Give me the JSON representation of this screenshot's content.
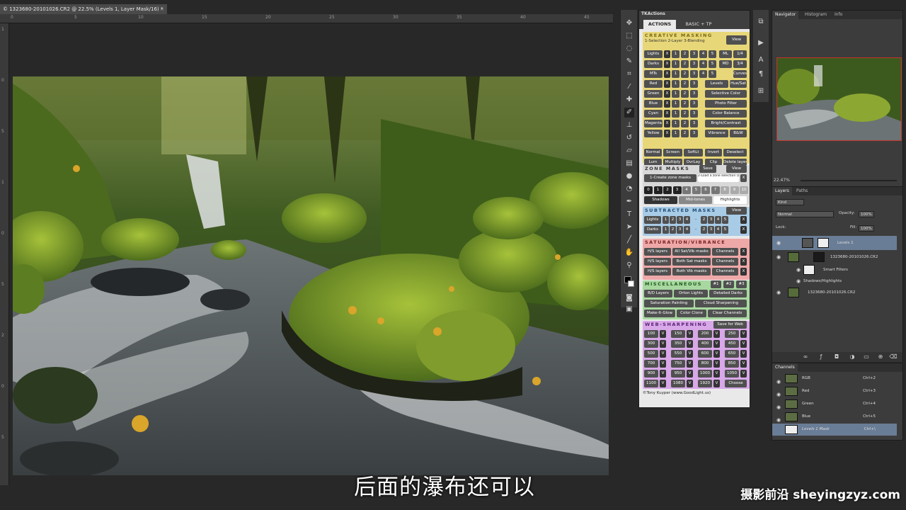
{
  "document": {
    "tab_title": "© 1323680-20101026.CR2 @ 22.5% (Levels 1, Layer Mask/16) *",
    "close": "×"
  },
  "rulers": {
    "top": [
      "0",
      "5",
      "10",
      "15",
      "20",
      "25",
      "30",
      "35",
      "40",
      "45"
    ],
    "left": [
      "1",
      "0",
      "5",
      "1",
      "0",
      "5",
      "2",
      "0",
      "5"
    ]
  },
  "subtitle": "后面的瀑布还可以",
  "watermark": "摄影前沿 sheyingzyz.com",
  "tk_panel": {
    "header": "TKActions",
    "tabs": [
      "ACTIONS",
      "BASIC + TP"
    ],
    "creative": {
      "title": "CREATIVE MASKING",
      "sub": "1-Selection  2-Layer  3-Blending",
      "view": "View",
      "rows": [
        [
          "Lights",
          "ML",
          "1/4"
        ],
        [
          "Darks",
          "MD",
          "3/4"
        ],
        [
          "MTs",
          "",
          "Curves"
        ],
        [
          "Red",
          "Levels",
          "Hue/Sat"
        ],
        [
          "Green",
          "Selective Color",
          ""
        ],
        [
          "Blue",
          "Photo Filter",
          ""
        ],
        [
          "Cyan",
          "Color Balance",
          ""
        ],
        [
          "Magenta",
          "Bright/Contrast",
          ""
        ],
        [
          "Yellow",
          "Vibrance",
          "B&W"
        ]
      ],
      "blend1": [
        "Normal",
        "Screen",
        "SoftLt",
        "Invert",
        "Deselect"
      ],
      "blend2": [
        "Lum",
        "Multiply",
        "OvrLay",
        "Clip",
        "Delete layer"
      ]
    },
    "zone": {
      "title": "ZONE MASKS",
      "save": "Save",
      "view": "View",
      "create": "1-Create zone masks",
      "load": "2-Load a zone selection (below)",
      "x": "X",
      "nums": [
        "0",
        "1",
        "2",
        "3",
        "4",
        "5",
        "6",
        "7",
        "8",
        "9",
        "10"
      ],
      "labels": [
        "Shadows",
        "Mid-tones",
        "Highlights"
      ]
    },
    "subtract": {
      "title": "SUBTRACTED MASKS",
      "view": "View",
      "rows": [
        "Lights",
        "Darks"
      ]
    },
    "saturation": {
      "title": "SATURATION/VIBRANCE",
      "rows": [
        [
          "H/S layers",
          "All Sat/Vib masks",
          "Channels"
        ],
        [
          "H/S layers",
          "Both Sat masks",
          "Channels"
        ],
        [
          "H/S layers",
          "Both Vib masks",
          "Channels"
        ]
      ]
    },
    "misc": {
      "title": "MISCELLANEOUS",
      "nums": [
        "#1",
        "#2",
        "#3"
      ],
      "rows": [
        [
          "B/D Layers",
          "Orton Lights",
          "Detailed Darks"
        ],
        [
          "Saturation Painting",
          "Cloud Sharpening"
        ],
        [
          "Make-It-Glow",
          "Color Clone",
          "Clear Channels"
        ]
      ]
    },
    "web": {
      "title": "WEB-SHARPENING",
      "save": "Save for Web",
      "values": [
        [
          "100",
          "150",
          "200",
          "250"
        ],
        [
          "300",
          "350",
          "400",
          "450"
        ],
        [
          "500",
          "550",
          "600",
          "650"
        ],
        [
          "700",
          "750",
          "800",
          "850"
        ],
        [
          "900",
          "950",
          "1000",
          "1050"
        ],
        [
          "1100",
          "1080",
          "1920",
          "Choose"
        ]
      ]
    },
    "credit": "©Tony Kuyper (www.GoodLight.us)"
  },
  "navigator": {
    "tabs": [
      "Navigator",
      "Histogram",
      "Info"
    ],
    "zoom": "22.47%"
  },
  "layers": {
    "tabs": [
      "Layers",
      "Paths"
    ],
    "kind": "Kind",
    "blend": "Normal",
    "opacity_label": "Opacity:",
    "opacity": "100%",
    "lock_label": "Lock:",
    "fill_label": "Fill:",
    "fill": "100%",
    "items": [
      {
        "name": "Levels 1"
      },
      {
        "name": "1323680-20101026.CR2"
      },
      {
        "name": "Smart Filters"
      },
      {
        "name": "Shadows/Highlights"
      },
      {
        "name": "1323680-20101026.CR2"
      }
    ]
  },
  "channels": {
    "tab": "Channels",
    "items": [
      {
        "name": "RGB",
        "shortcut": "Ctrl+2"
      },
      {
        "name": "Red",
        "shortcut": "Ctrl+3"
      },
      {
        "name": "Green",
        "shortcut": "Ctrl+4"
      },
      {
        "name": "Blue",
        "shortcut": "Ctrl+5"
      },
      {
        "name": "Levels 1 Mask",
        "shortcut": "Ctrl+\\"
      }
    ]
  }
}
